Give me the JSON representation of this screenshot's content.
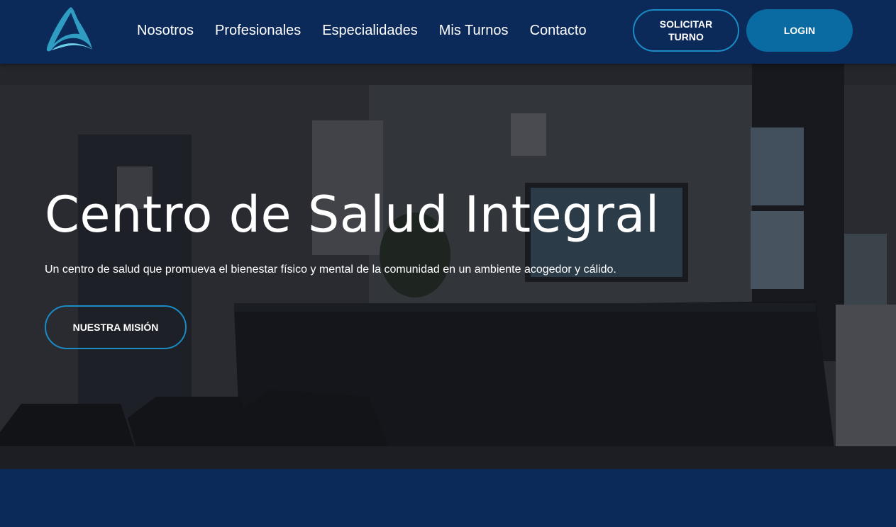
{
  "header": {
    "logo_icon": "brand-triangle-logo",
    "nav": [
      {
        "label": "Nosotros"
      },
      {
        "label": "Profesionales"
      },
      {
        "label": "Especialidades"
      },
      {
        "label": "Mis Turnos"
      },
      {
        "label": "Contacto"
      }
    ],
    "solicitar_label": "SOLICITAR TURNO",
    "login_label": "LOGIN"
  },
  "hero": {
    "title": "Centro de Salud Integral",
    "subtitle": "Un centro de salud que promueva el bienestar físico y mental de la comunidad en un ambiente acogedor y cálido.",
    "cta_label": "NUESTRA MISIÓN"
  },
  "colors": {
    "navy": "#0b2a5a",
    "accent_blue": "#0a6aa2",
    "outline_blue": "#1a8bc4",
    "logo_cyan": "#4fc3de"
  }
}
